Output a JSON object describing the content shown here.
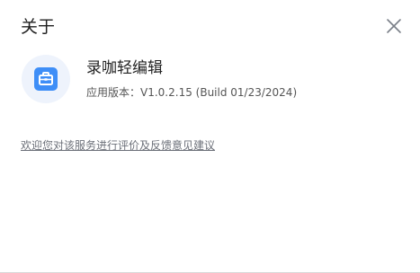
{
  "dialog": {
    "title": "关于",
    "close_icon": "close-icon"
  },
  "app": {
    "icon": "briefcase-app-icon",
    "name": "录咖轻编辑",
    "version_label": "应用版本：",
    "version_value": "V1.0.2.15 (Build 01/23/2024)"
  },
  "feedback": {
    "link_text": "欢迎您对该服务进行评价及反馈意见建议"
  },
  "colors": {
    "icon_blue": "#3e8ef7",
    "icon_bg": "#eef3fc",
    "close_gray": "#7a7f88"
  }
}
